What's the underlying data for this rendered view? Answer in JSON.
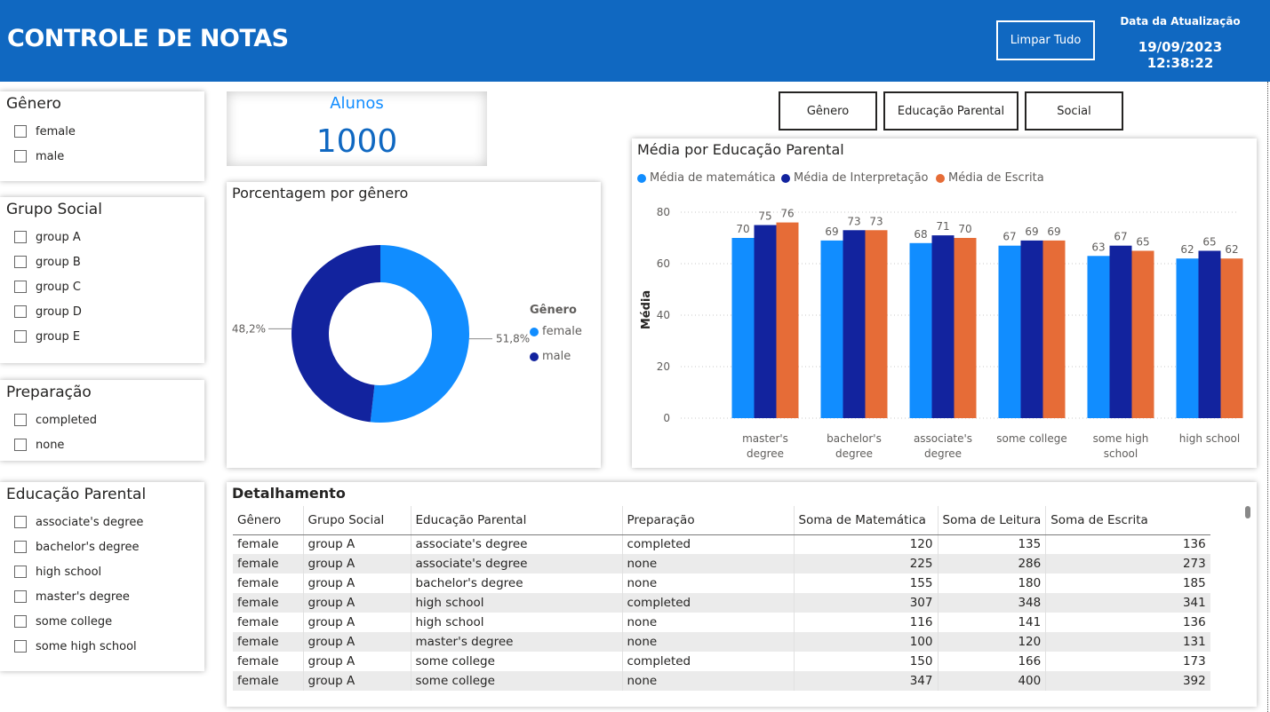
{
  "header": {
    "title": "CONTROLE DE NOTAS",
    "clear_label": "Limpar Tudo",
    "update_label": "Data da Atualização",
    "update_value": "19/09/2023 12:38:22"
  },
  "slicers": {
    "genero": {
      "title": "Gênero",
      "items": [
        "female",
        "male"
      ]
    },
    "grupo_social": {
      "title": "Grupo Social",
      "items": [
        "group A",
        "group B",
        "group C",
        "group D",
        "group E"
      ]
    },
    "preparacao": {
      "title": "Preparação",
      "items": [
        "completed",
        "none"
      ]
    },
    "educacao_parental": {
      "title": "Educação Parental",
      "items": [
        "associate's degree",
        "bachelor's degree",
        "high school",
        "master's degree",
        "some college",
        "some high school"
      ]
    }
  },
  "kpi": {
    "label": "Alunos",
    "value": "1000"
  },
  "nav_buttons": [
    "Gênero",
    "Educação Parental",
    "Social"
  ],
  "colors": {
    "header_bg": "#1068c1",
    "female": "#118dff",
    "male": "#12239e",
    "matematica": "#118dff",
    "interpretacao": "#12239e",
    "escrita": "#e66c37"
  },
  "chart_data": [
    {
      "type": "pie",
      "title": "Porcentagem por gênero",
      "donut": true,
      "legend_title": "Gênero",
      "legend_position": "right",
      "categories": [
        "female",
        "male"
      ],
      "values": [
        51.8,
        48.2
      ],
      "labels": [
        "51,8%",
        "48,2%"
      ]
    },
    {
      "type": "bar",
      "title": "Média por Educação Parental",
      "ylabel": "Média",
      "ylim": [
        0,
        80
      ],
      "yticks": [
        0,
        20,
        40,
        60,
        80
      ],
      "legend_position": "top-left",
      "categories": [
        "master's degree",
        "bachelor's degree",
        "associate's degree",
        "some college",
        "some high school",
        "high school"
      ],
      "category_lines": [
        [
          "master's",
          "degree"
        ],
        [
          "bachelor's",
          "degree"
        ],
        [
          "associate's",
          "degree"
        ],
        [
          "some college"
        ],
        [
          "some high",
          "school"
        ],
        [
          "high school"
        ]
      ],
      "series": [
        {
          "name": "Média de matemática",
          "values": [
            70,
            69,
            68,
            67,
            63,
            62
          ]
        },
        {
          "name": "Média de Interpretação",
          "values": [
            75,
            73,
            71,
            69,
            67,
            65
          ]
        },
        {
          "name": "Média de Escrita",
          "values": [
            76,
            73,
            70,
            69,
            65,
            62
          ]
        }
      ]
    }
  ],
  "table": {
    "title": "Detalhamento",
    "columns": [
      "Gênero",
      "Grupo Social",
      "Educação Parental",
      "Preparação",
      "Soma de Matemática",
      "Soma de Leitura",
      "Soma de Escrita"
    ],
    "rows": [
      [
        "female",
        "group A",
        "associate's degree",
        "completed",
        "120",
        "135",
        "136"
      ],
      [
        "female",
        "group A",
        "associate's degree",
        "none",
        "225",
        "286",
        "273"
      ],
      [
        "female",
        "group A",
        "bachelor's degree",
        "none",
        "155",
        "180",
        "185"
      ],
      [
        "female",
        "group A",
        "high school",
        "completed",
        "307",
        "348",
        "341"
      ],
      [
        "female",
        "group A",
        "high school",
        "none",
        "116",
        "141",
        "136"
      ],
      [
        "female",
        "group A",
        "master's degree",
        "none",
        "100",
        "120",
        "131"
      ],
      [
        "female",
        "group A",
        "some college",
        "completed",
        "150",
        "166",
        "173"
      ],
      [
        "female",
        "group A",
        "some college",
        "none",
        "347",
        "400",
        "392"
      ]
    ]
  }
}
